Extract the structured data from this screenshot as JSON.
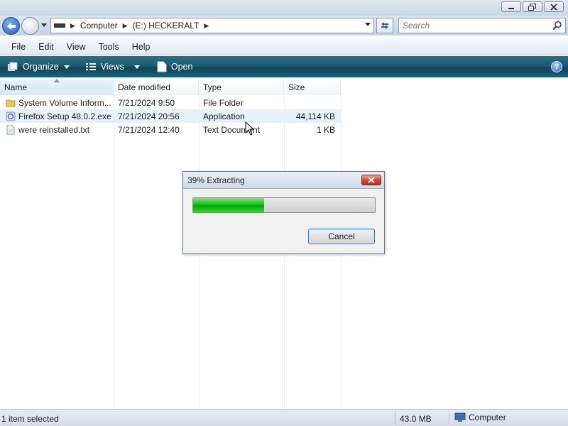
{
  "address": {
    "crumbs": [
      "Computer",
      "(E:) HECKERALT"
    ],
    "search_placeholder": "Search"
  },
  "menu": [
    "File",
    "Edit",
    "View",
    "Tools",
    "Help"
  ],
  "commands": {
    "organize": "Organize",
    "views": "Views",
    "open": "Open",
    "help": "?"
  },
  "columns": [
    "Name",
    "Date modified",
    "Type",
    "Size"
  ],
  "files": [
    {
      "name": "System Volume Inform...",
      "date": "7/21/2024 9:50",
      "type": "File Folder",
      "size": "",
      "icon": "folder-icon",
      "selected": false
    },
    {
      "name": "Firefox Setup 48.0.2.exe",
      "date": "7/21/2024 20:56",
      "type": "Application",
      "size": "44,114 KB",
      "icon": "installer-icon",
      "selected": true
    },
    {
      "name": "were reinstalled.txt",
      "date": "7/21/2024 12:40",
      "type": "Text Document",
      "size": "1 KB",
      "icon": "text-file-icon",
      "selected": false
    }
  ],
  "dialog": {
    "title": "39% Extracting",
    "progress_percent": 39,
    "cancel_label": "Cancel"
  },
  "status": {
    "selection": "1 item selected",
    "size": "43.0 MB",
    "location": "Computer"
  },
  "colors": {
    "command_bar": "#1d5a70",
    "progress_green": "#16c016",
    "selection": "#e6f1fb",
    "close_red": "#c8442e"
  }
}
